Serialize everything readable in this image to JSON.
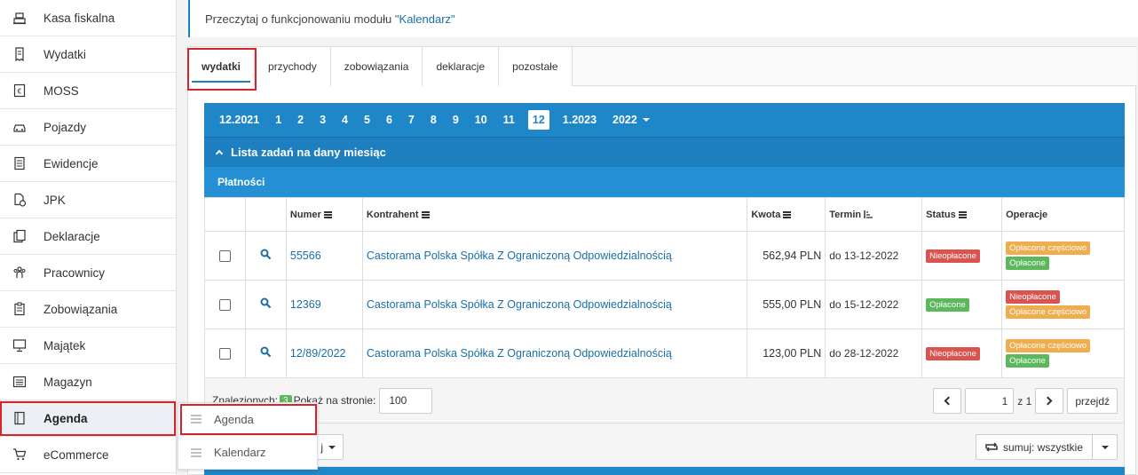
{
  "sidebar": {
    "items": [
      {
        "label": "Kasa fiskalna",
        "icon": "cash-register-icon"
      },
      {
        "label": "Wydatki",
        "icon": "receipt-icon"
      },
      {
        "label": "MOSS",
        "icon": "euro-icon"
      },
      {
        "label": "Pojazdy",
        "icon": "car-icon"
      },
      {
        "label": "Ewidencje",
        "icon": "ledger-icon"
      },
      {
        "label": "JPK",
        "icon": "file-clock-icon"
      },
      {
        "label": "Deklaracje",
        "icon": "documents-icon"
      },
      {
        "label": "Pracownicy",
        "icon": "people-icon"
      },
      {
        "label": "Zobowiązania",
        "icon": "clipboard-icon"
      },
      {
        "label": "Majątek",
        "icon": "monitor-icon"
      },
      {
        "label": "Magazyn",
        "icon": "warehouse-icon"
      },
      {
        "label": "Agenda",
        "icon": "notebook-icon"
      },
      {
        "label": "eCommerce",
        "icon": "cart-icon"
      }
    ],
    "active": "Agenda"
  },
  "submenu": {
    "items": [
      {
        "label": "Agenda"
      },
      {
        "label": "Kalendarz"
      }
    ]
  },
  "info": {
    "text": "Przeczytaj o funkcjonowaniu modułu ",
    "link": "\"Kalendarz\""
  },
  "tabs": [
    "wydatki",
    "przychody",
    "zobowiązania",
    "deklaracje",
    "pozostałe"
  ],
  "active_tab": "wydatki",
  "months": {
    "prev": "12.2021",
    "items": [
      "1",
      "2",
      "3",
      "4",
      "5",
      "6",
      "7",
      "8",
      "9",
      "10",
      "11",
      "12"
    ],
    "selected": "12",
    "next": "1.2023",
    "year": "2022"
  },
  "tasks_header": "Lista zadań na dany miesiąc",
  "payments_header": "Płatności",
  "table": {
    "headers": {
      "numer": "Numer",
      "kontrahent": "Kontrahent",
      "kwota": "Kwota",
      "termin": "Termin",
      "status": "Status",
      "operacje": "Operacje"
    },
    "rows": [
      {
        "numer": "55566",
        "kontrahent": "Castorama Polska Spółka Z Ograniczoną Odpowiedzialnością",
        "kwota": "562,94 PLN",
        "termin": "do 13-12-2022",
        "status": "Nieopłacone",
        "ops": [
          "Opłacone częściowo",
          "Opłacone"
        ]
      },
      {
        "numer": "12369",
        "kontrahent": "Castorama Polska Spółka Z Ograniczoną Odpowiedzialnością",
        "kwota": "555,00 PLN",
        "termin": "do 15-12-2022",
        "status": "Opłacone",
        "ops": [
          "Nieopłacone",
          "Opłacone częściowo"
        ]
      },
      {
        "numer": "12/89/2022",
        "kontrahent": "Castorama Polska Spółka Z Ograniczoną Odpowiedzialnością",
        "kwota": "123,00 PLN",
        "termin": "do 28-12-2022",
        "status": "Nieopłacone",
        "ops": [
          "Opłacone częściowo",
          "Opłacone"
        ]
      }
    ]
  },
  "footer": {
    "found_label": "Znalezionych:",
    "found_count": "3",
    "per_page_label": "Pokaż na stronie:",
    "per_page": "100",
    "page": "1",
    "of_pages": "z 1",
    "go_label": "przejdź"
  },
  "bottom": {
    "dropdown_suffix": "j",
    "sum_label": "sumuj: wszystkie"
  },
  "colors": {
    "accent": "#1f86c8",
    "danger": "#d9534f",
    "success": "#5cb85c",
    "warning": "#f0ad4e",
    "highlight": "#d9232a"
  }
}
